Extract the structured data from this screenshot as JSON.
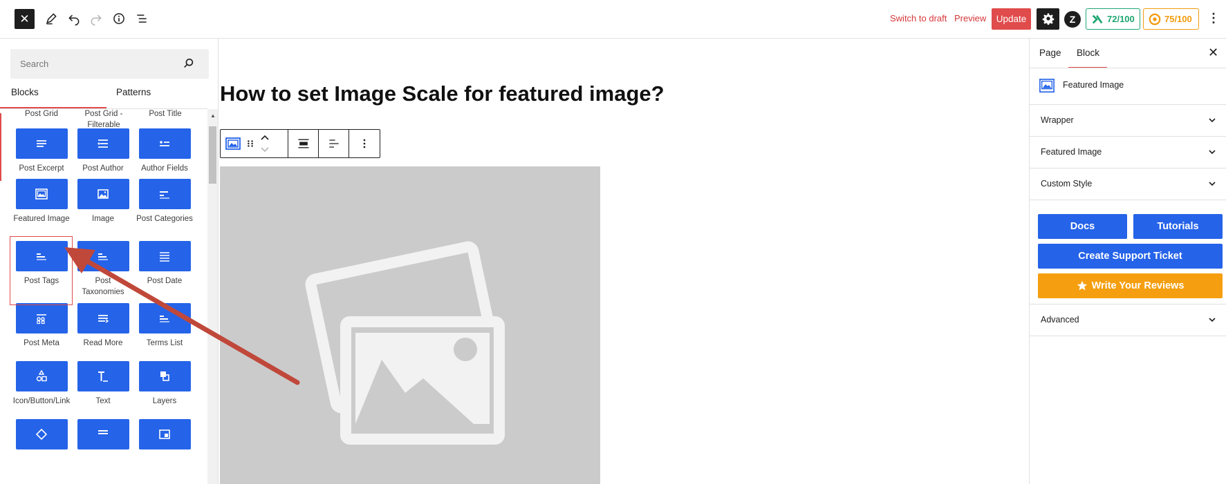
{
  "topbar": {
    "close_glyph": "✕",
    "switch_to_draft": "Switch to draft",
    "preview": "Preview",
    "update": "Update",
    "brand_letter": "Z",
    "score_1": "72/100",
    "score_2": "75/100",
    "more_glyph": "⋮",
    "icons": [
      "close-icon",
      "pen-tool-icon",
      "undo-icon",
      "redo-icon",
      "info-icon",
      "list-view-icon",
      "gear-icon",
      "zilla-logo-icon",
      "readability-icon",
      "seo-score-icon",
      "more-options-icon"
    ]
  },
  "inserter": {
    "search_placeholder": "Search",
    "tabs": [
      "Blocks",
      "Patterns"
    ],
    "top_row_labels": [
      {
        "label": "Post Grid"
      },
      {
        "label": "Post Grid - Filterable"
      },
      {
        "label": "Post Title"
      }
    ],
    "blocks": [
      {
        "label": "Post Excerpt",
        "icon": "excerpt-icon"
      },
      {
        "label": "Post Author",
        "icon": "author-icon"
      },
      {
        "label": "Author Fields",
        "icon": "author-fields-icon"
      },
      {
        "label": "Featured Image",
        "icon": "featured-image-icon"
      },
      {
        "label": "Image",
        "icon": "image-icon"
      },
      {
        "label": "Post Categories",
        "icon": "categories-icon"
      },
      {
        "label": "Post Tags",
        "icon": "tags-icon"
      },
      {
        "label": "Post Taxonomies",
        "icon": "taxonomies-icon"
      },
      {
        "label": "Post Date",
        "icon": "date-icon"
      },
      {
        "label": "Post Meta",
        "icon": "meta-icon"
      },
      {
        "label": "Read More",
        "icon": "read-more-icon"
      },
      {
        "label": "Terms List",
        "icon": "terms-list-icon"
      },
      {
        "label": "Icon/Button/Link",
        "icon": "shapes-icon"
      },
      {
        "label": "Text",
        "icon": "text-icon"
      },
      {
        "label": "Layers",
        "icon": "layers-icon"
      },
      {
        "label": "",
        "icon": "diamond-icon"
      },
      {
        "label": "",
        "icon": "lines-icon"
      },
      {
        "label": "",
        "icon": "window-icon"
      }
    ],
    "accent_color": "#2563e8"
  },
  "canvas": {
    "title": "How to set Image Scale for featured image?",
    "placeholder_color": "#cbcbcb"
  },
  "sidebar": {
    "tabs": [
      "Page",
      "Block"
    ],
    "close_glyph": "✕",
    "block_name": "Featured Image",
    "panels": [
      "Wrapper",
      "Featured Image",
      "Custom Style"
    ],
    "buttons": {
      "docs": "Docs",
      "tutorials": "Tutorials",
      "support": "Create Support Ticket",
      "reviews": "Write Your Reviews"
    },
    "advanced": "Advanced"
  },
  "colors": {
    "accent_red": "#e04b4b",
    "block_blue": "#2563e8",
    "review_yellow": "#f59f10",
    "score_green": "#1ea672",
    "score_orange": "#f29a0e",
    "arrow_red": "#c0483a"
  }
}
